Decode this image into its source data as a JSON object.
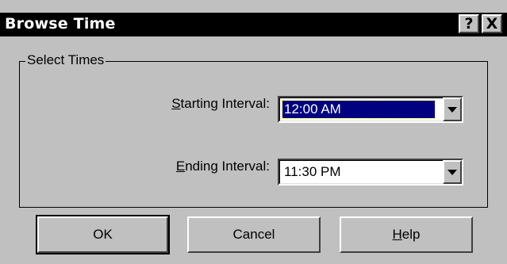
{
  "window": {
    "title": "Browse Time",
    "help_glyph": "?",
    "close_glyph": "X"
  },
  "group": {
    "label": "Select Times"
  },
  "starting": {
    "label_mnemonic": "S",
    "label_rest": "tarting Interval:",
    "value": "12:00 AM"
  },
  "ending": {
    "label_mnemonic": "E",
    "label_rest": "nding Interval:",
    "value": "11:30 PM"
  },
  "buttons": {
    "ok": "OK",
    "cancel": "Cancel",
    "help_mnemonic": "H",
    "help_rest": "elp"
  }
}
